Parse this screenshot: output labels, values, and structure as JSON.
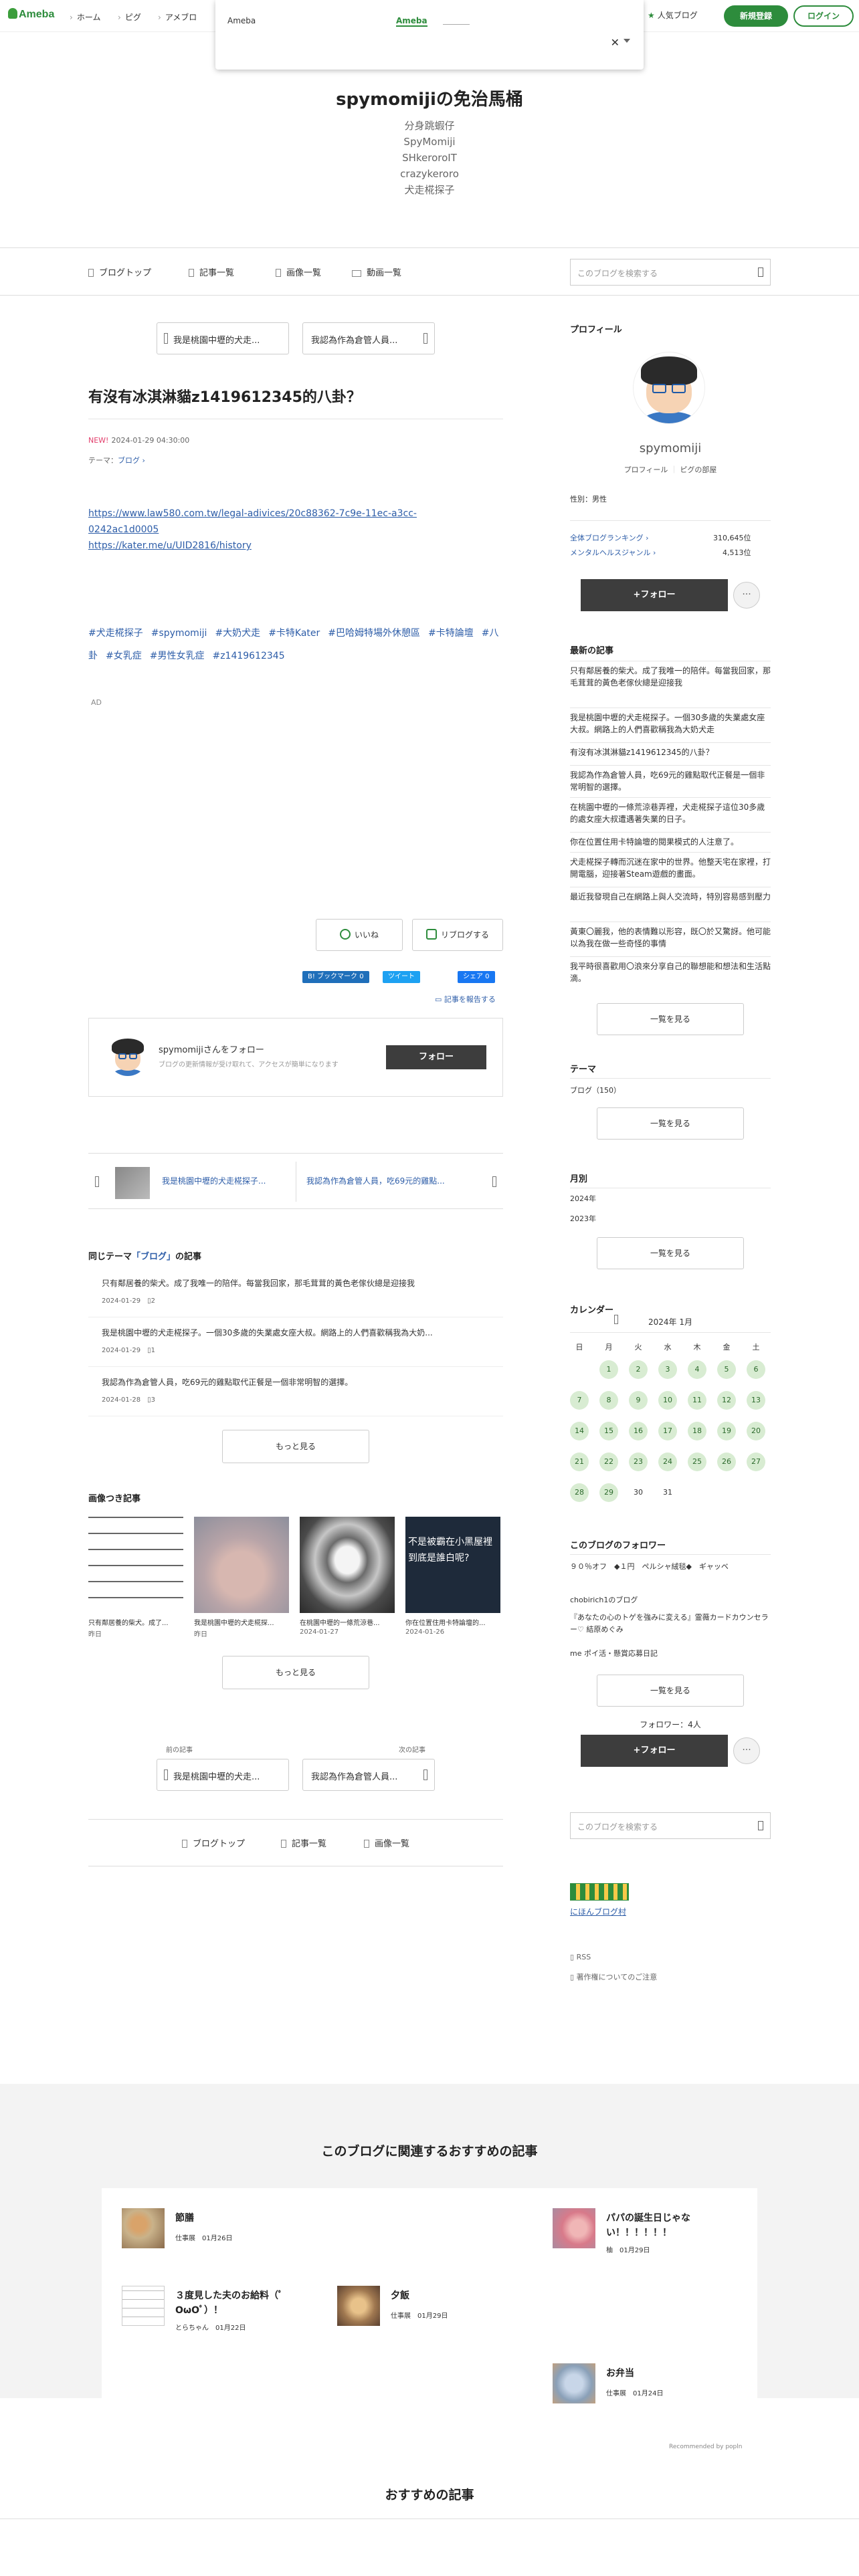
{
  "header": {
    "logo": "Ameba",
    "nav": [
      "ホーム",
      "ピグ",
      "アメブロ"
    ],
    "popup": {
      "label": "Ameba",
      "tab": "Ameba"
    },
    "popular_label": "人気ブログ",
    "signup_label": "新規登録",
    "login_label": "ログイン"
  },
  "blog": {
    "title": "spymomijiの免治馬桶",
    "description": [
      "分身跳蝦仔",
      "SpyMomiji",
      "SHkeroroIT",
      "crazykeroro",
      "犬走椛探子"
    ]
  },
  "blognav": {
    "items": [
      "ブログトップ",
      "記事一覧",
      "画像一覧",
      "動画一覧"
    ],
    "search_placeholder": "このブログを検索する"
  },
  "article": {
    "prev_top": "我是桃園中壢的犬走...",
    "next_top": "我認為作為倉管人員...",
    "title": "有沒有冰淇淋貓z1419612345的八卦？",
    "new_badge": "NEW!",
    "date": "2024-01-29 04:30:00",
    "theme_prefix": "テーマ：",
    "theme": "ブログ",
    "links": [
      "https://www.law580.com.tw/legal-adivices/20c88362-7c9e-11ec-a3cc-",
      "0242ac1d0005",
      "https://kater.me/u/UID2816/history"
    ],
    "tags": [
      "#犬走椛探子",
      "#spymomiji",
      "#大奶犬走",
      "#卡特Kater",
      "#巴哈姆特場外休憩區",
      "#卡特論壇",
      "#八卦",
      "#女乳症",
      "#男性女乳症",
      "#z1419612345"
    ],
    "ad": "AD",
    "like_label": "いいね",
    "reblog_label": "リブログする",
    "share_hatena": "B! ブックマーク 0",
    "share_tweet": "ツイート",
    "share_fb": "シェア 0",
    "report": "記事を報告する"
  },
  "follow": {
    "name": "spymomijiさんをフォロー",
    "sub": "ブログの更新情報が受け取れて、アクセスが簡単になります",
    "button": "フォロー"
  },
  "prevnext_bar": {
    "prev": "我是桃園中壢的犬走椛探子...",
    "next": "我認為作為倉管人員，吃69元的雞點..."
  },
  "same_theme": {
    "heading_pre": "同じテーマ",
    "heading_theme": "「ブログ」",
    "heading_post": "の記事",
    "items": [
      {
        "title": "只有鄰居養的柴犬。成了我唯一的陪伴。每當我回家，那毛茸茸的黃色老傢伙總是迎接我",
        "date": "2024-01-29",
        "count": "2"
      },
      {
        "title": "我是桃園中壢的犬走椛探子。一個30多歲的失業處女座大叔。網路上的人們喜歡稱我為大奶...",
        "date": "2024-01-29",
        "count": "1"
      },
      {
        "title": "我認為作為倉管人員，吃69元的雞點取代正餐是一個非常明智的選擇。",
        "date": "2024-01-28",
        "count": "3"
      }
    ],
    "more": "もっと見る"
  },
  "image_articles": {
    "heading": "画像つき記事",
    "items": [
      {
        "caption": "只有鄰居養的柴犬。成了...",
        "date": "昨日"
      },
      {
        "caption": "我是桃園中壢的犬走椛探...",
        "date": "昨日"
      },
      {
        "caption": "在桃園中壢的一條荒涼巷...",
        "date": "2024-01-27"
      },
      {
        "caption": "你在位置住用卡特論壇的...",
        "date": "2024-01-26",
        "overlay": "不是被霸在小黑屋裡 到底是誰白呢?"
      }
    ],
    "more": "もっと見る"
  },
  "bottom_pn": {
    "prev_label": "前の記事",
    "next_label": "次の記事",
    "prev": "我是桃園中壢的犬走...",
    "next": "我認為作為倉管人員..."
  },
  "bottom_nav": [
    "ブログトップ",
    "記事一覧",
    "画像一覧"
  ],
  "sidebar": {
    "profile_h": "プロフィール",
    "name": "spymomiji",
    "profile_link": "プロフィール",
    "pigg_link": "ピグの部屋",
    "gender": "性別：男性",
    "rank1_label": "全体ブログランキング",
    "rank1_value": "310,645位",
    "rank2_label": "メンタルヘルスジャンル",
    "rank2_value": "4,513位",
    "follow_btn": "+フォロー",
    "more_dots": "···",
    "recent_h": "最新の記事",
    "recent": [
      "只有鄰居養的柴犬。成了我唯一的陪伴。每當我回家，那毛茸茸的黃色老傢伙總是迎接我",
      "我是桃園中壢的犬走椛探子。一個30多歲的失業處女座大叔。網路上的人們喜歡稱我為大奶犬走",
      "有沒有冰淇淋貓z1419612345的八卦？",
      "我認為作為倉管人員，吃69元的雞點取代正餐是一個非常明智的選擇。",
      "在桃園中壢的一條荒涼巷弄裡，犬走椛探子這位30多歲的處女座大叔遭遇著失業的日子。",
      "你在位置住用卡特論壇的閱果模式的人注意了。",
      "犬走椛探子轉而沉迷在家中的世界。他整天宅在家裡，打開電腦，迎接著Steam遊戲的畫面。",
      "最近我發現自己在網路上與人交流時，特別容易感到壓力",
      "黃東〇麗我，他的表情難以形容，既〇於又驚訝。他可能以為我在做一些奇怪的事情",
      "我平時很喜歡用〇浪來分享自己的聯想能和想法和生活點滴。"
    ],
    "list_btn": "一覧を見る",
    "theme_h": "テーマ",
    "theme_item": "ブログ（150）",
    "monthly_h": "月別",
    "months": [
      "2024年",
      "2023年"
    ],
    "calendar_h": "カレンダー",
    "calendar_month": "2024年 1月",
    "weekdays": [
      "日",
      "月",
      "火",
      "水",
      "木",
      "金",
      "土"
    ],
    "days": [
      "1",
      "2",
      "3",
      "4",
      "5",
      "6",
      "7",
      "8",
      "9",
      "10",
      "11",
      "12",
      "13",
      "14",
      "15",
      "16",
      "17",
      "18",
      "19",
      "20",
      "21",
      "22",
      "23",
      "24",
      "25",
      "26",
      "27",
      "28",
      "29",
      "30",
      "31"
    ],
    "followers_h": "このブログのフォロワー",
    "followers": [
      "９０％オフ　◆１円　ペルシャ絨毯◆　ギャッベ",
      "chobirich1のブログ",
      "『あなたの心のトゲを強みに変える』霊薇カードカウンセラー♡ 結原めぐみ",
      "me ポイ活・懸賞応募日記"
    ],
    "follower_count": "フォロワー：4人",
    "search_placeholder": "このブログを検索する",
    "banner_text": "にほんブログ村",
    "rss": "RSS",
    "copyright": "著作権についてのご注意"
  },
  "recommend": {
    "title": "このブログに関連するおすすめの記事",
    "items": [
      {
        "title": "節膳",
        "author": "仕事展",
        "date": "01月26日"
      },
      {
        "title": "パパの誕生日じゃない！！！！！！",
        "author": "柚",
        "date": "01月29日"
      },
      {
        "title": "３度見した夫のお給料（ﾟОωОﾟ）！",
        "author": "とらちゃん",
        "date": "01月22日"
      },
      {
        "title": "夕飯",
        "author": "仕事展",
        "date": "01月29日"
      },
      {
        "title": "お弁当",
        "author": "仕事展",
        "date": "01月24日"
      }
    ],
    "by": "Recommended by  popln",
    "title2": "おすすめの記事"
  },
  "colors": {
    "brand": "#2d8c3c",
    "link": "#2d5da8",
    "new": "#e23d6b"
  }
}
